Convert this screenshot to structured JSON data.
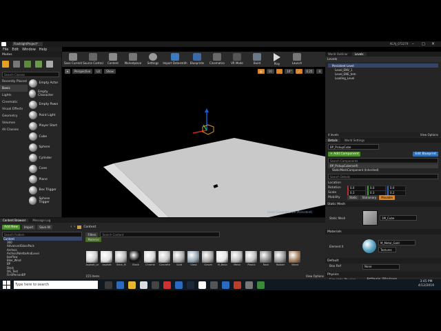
{
  "window": {
    "tab_title": "FlashlightProject*",
    "user_label": "KCAJ_072279"
  },
  "menu": [
    "File",
    "Edit",
    "Window",
    "Help"
  ],
  "modes": {
    "title": "Modes",
    "search_placeholder": "Search Classes",
    "categories": [
      "Recently Placed",
      "Basic",
      "Lights",
      "Cinematic",
      "Visual Effects",
      "Geometry",
      "Volumes",
      "All Classes"
    ],
    "selected_category": "Basic",
    "items": [
      "Empty Actor",
      "Empty Character",
      "Empty Pawn",
      "Point Light",
      "Player Start",
      "Cube",
      "Sphere",
      "Cylinder",
      "Cone",
      "Plane",
      "Box Trigger",
      "Sphere Trigger"
    ]
  },
  "toolbar": {
    "buttons": [
      "Save Current",
      "Source Control",
      "Content",
      "Marketplace",
      "Settings",
      "Import Datasmith",
      "Blueprints",
      "Cinematics",
      "VR Mode",
      "Build",
      "Play",
      "Launch"
    ]
  },
  "viewport": {
    "view_mode": "Perspective",
    "lighting": "Lit",
    "show": "Show",
    "grid_value": "10",
    "angle_value": "10°",
    "scale_value": "0.25",
    "camera_speed": "4",
    "level_label": "Level: ExampleLevel (Persistent)"
  },
  "world_outliner": {
    "tabs": [
      "World Outliner",
      "Levels"
    ],
    "title": "Levels",
    "items": [
      "Persistent Level",
      "Level_ENV_1",
      "Level_ENE_tem",
      "Loading_Level"
    ],
    "footer": "4 levels",
    "view_options": "View Options"
  },
  "details": {
    "tabs": [
      "Details",
      "World Settings"
    ],
    "actor_name": "BP_PickupCube",
    "add_component": "+ Add Component",
    "edit_blueprint": "Edit Blueprint",
    "search_placeholder": "Search Components",
    "components": [
      "BP_PickupCube(self)",
      "StaticMeshComponent (Inherited)"
    ],
    "search_details_placeholder": "Search Details",
    "transform": {
      "location_label": "Location",
      "rotation_label": "Rotation",
      "scale_label": "Scale",
      "mobility_label": "Mobility",
      "rotation": [
        "0.0",
        "0.0",
        "0.0"
      ],
      "scale": [
        "0.3",
        "0.3",
        "0.2"
      ],
      "mobility_options": [
        "Static",
        "Stationary",
        "Movable"
      ]
    },
    "static_mesh_section": "Static Mesh",
    "static_mesh_label": "Static Mesh",
    "static_mesh_value": "1M_Cube",
    "materials_section": "Materials",
    "element0_label": "Element 0",
    "element0_value": "M_Metal_Gold",
    "element0_texture": "Textures",
    "default_section": "Default",
    "box_ref_label": "Box Ref",
    "box_ref_value": "None",
    "physics_section": "Physics",
    "simulate_physics_label": "Simulate Physics",
    "activate_windows_title": "Activate Windows",
    "activate_windows_sub": "Go to Settings to activate Windows."
  },
  "content_browser": {
    "tabs": [
      "Content Browser",
      "Message Log"
    ],
    "add_new": "Add New",
    "import": "Import",
    "save_all": "Save All",
    "path": "Content",
    "search_folders": "Search Folders",
    "filters": "Filters",
    "search_content": "Search Content",
    "folder_tree": [
      "Content",
      "360",
      "AdvancedGlassPack",
      "Archvis",
      "ArchvisPaletteAndLevel",
      "boxflow",
      "Bike_Wind",
      "BP",
      "Deck",
      "DG_Test",
      "FirstPersonBP"
    ],
    "filter_chip": "Material",
    "assets": [
      "Asphalt_Level_ALBEDO",
      "Asphalt",
      "Brick_M",
      "Black",
      "Chrome",
      "Concrete",
      "Gold",
      "Glass",
      "Gravel",
      "M_Basic",
      "Metal",
      "Plastic",
      "Rock",
      "Rubber",
      "Wood"
    ],
    "item_count": "155 items",
    "view_options": "View Options"
  },
  "taskbar": {
    "search_placeholder": "Type here to search",
    "time": "3:45 PM",
    "date": "4/12/2019"
  },
  "colors": {
    "accent_blue": "#2f6fb5",
    "accent_green": "#4d8f2a",
    "accent_orange": "#e0a020",
    "panel": "#262626"
  }
}
